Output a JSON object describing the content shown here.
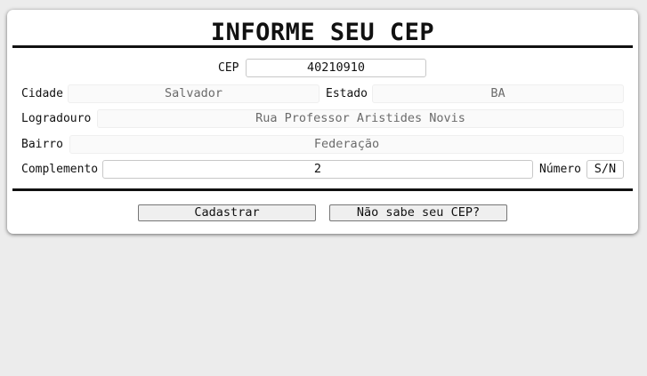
{
  "form": {
    "title": "INFORME SEU CEP",
    "cep": {
      "label": "CEP",
      "value": "40210910"
    },
    "cidade": {
      "label": "Cidade",
      "value": "Salvador"
    },
    "estado": {
      "label": "Estado",
      "value": "BA"
    },
    "logradouro": {
      "label": "Logradouro",
      "value": "Rua Professor Aristides Novis"
    },
    "bairro": {
      "label": "Bairro",
      "value": "Federação"
    },
    "complemento": {
      "label": "Complemento",
      "value": "2"
    },
    "numero": {
      "label": "Número",
      "value": "S/N"
    }
  },
  "actions": {
    "submit_label": "Cadastrar",
    "help_label": "Não sabe seu CEP?"
  }
}
